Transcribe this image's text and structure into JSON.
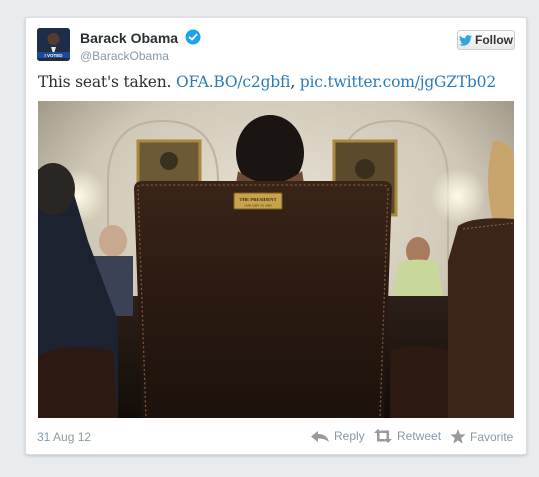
{
  "author": {
    "name": "Barack Obama",
    "handle": "@BarackObama",
    "avatar_badge": "I VOTED"
  },
  "follow_button": {
    "label": "Follow"
  },
  "tweet": {
    "text": "This seat's taken.",
    "link": "OFA.BO/c2gbfi",
    "pic_link": "pic.twitter.com/jgGZTb02"
  },
  "photo": {
    "plaque_line1": "THE PRESIDENT",
    "plaque_line2": "JANUARY 20, 2009"
  },
  "footer": {
    "date": "31 Aug 12",
    "reply": "Reply",
    "retweet": "Retweet",
    "favorite": "Favorite"
  },
  "colors": {
    "link": "#2b7bb9",
    "verified": "#1da1f2",
    "muted": "#8899a6"
  }
}
